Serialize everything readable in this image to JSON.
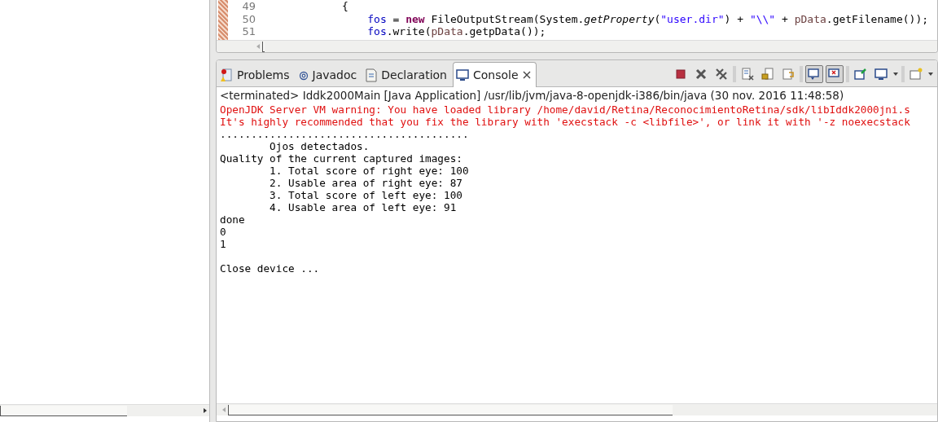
{
  "editor": {
    "lines": [
      {
        "number": "49",
        "tokens": [
          {
            "kind": "plain",
            "text": "            {"
          }
        ]
      },
      {
        "number": "50",
        "tokens": [
          {
            "kind": "field",
            "text": "                fos"
          },
          {
            "kind": "plain",
            "text": " = "
          },
          {
            "kind": "keyword",
            "text": "new"
          },
          {
            "kind": "plain",
            "text": " FileOutputStream(System."
          },
          {
            "kind": "static",
            "text": "getProperty"
          },
          {
            "kind": "plain",
            "text": "("
          },
          {
            "kind": "string",
            "text": "\"user.dir\""
          },
          {
            "kind": "plain",
            "text": ") + "
          },
          {
            "kind": "string",
            "text": "\"\\\\\""
          },
          {
            "kind": "plain",
            "text": " + "
          },
          {
            "kind": "param",
            "text": "pData"
          },
          {
            "kind": "plain",
            "text": ".getFilename());"
          }
        ]
      },
      {
        "number": "51",
        "tokens": [
          {
            "kind": "field",
            "text": "                fos"
          },
          {
            "kind": "plain",
            "text": ".write("
          },
          {
            "kind": "param",
            "text": "pData"
          },
          {
            "kind": "plain",
            "text": ".getpData());"
          }
        ]
      }
    ]
  },
  "view_tabs": [
    {
      "label": "Problems",
      "kind": "problems",
      "selected": false
    },
    {
      "label": "Javadoc",
      "kind": "javadoc",
      "selected": false
    },
    {
      "label": "Declaration",
      "kind": "declaration",
      "selected": false
    },
    {
      "label": "Console",
      "kind": "console",
      "selected": true
    }
  ],
  "toolbar": [
    {
      "kind": "terminate",
      "on": false
    },
    {
      "kind": "remove",
      "on": false
    },
    {
      "kind": "remove-all",
      "on": false
    },
    {
      "kind": "sep"
    },
    {
      "kind": "clear",
      "on": false
    },
    {
      "kind": "scroll-lock",
      "on": false
    },
    {
      "kind": "word-wrap",
      "on": false
    },
    {
      "kind": "sep"
    },
    {
      "kind": "show-out",
      "on": true
    },
    {
      "kind": "show-err",
      "on": true
    },
    {
      "kind": "sep"
    },
    {
      "kind": "pin",
      "on": false
    },
    {
      "kind": "display",
      "on": false
    },
    {
      "kind": "caret"
    },
    {
      "kind": "sep"
    },
    {
      "kind": "open",
      "on": false
    },
    {
      "kind": "caret"
    }
  ],
  "console": {
    "header": "<terminated> Iddk2000Main [Java Application] /usr/lib/jvm/java-8-openjdk-i386/bin/java (30 nov. 2016 11:48:58)",
    "lines": [
      {
        "kind": "err",
        "text": "OpenJDK Server VM warning: You have loaded library /home/david/Retina/ReconocimientoRetina/sdk/libIddk2000jni.s"
      },
      {
        "kind": "err",
        "text": "It's highly recommended that you fix the library with 'execstack -c <libfile>', or link it with '-z noexecstack"
      },
      {
        "kind": "out",
        "text": "........................................"
      },
      {
        "kind": "out",
        "text": "\tOjos detectados."
      },
      {
        "kind": "out",
        "text": "Quality of the current captured images:"
      },
      {
        "kind": "out",
        "text": "\t1. Total score of right eye: 100"
      },
      {
        "kind": "out",
        "text": "\t2. Usable area of right eye: 87"
      },
      {
        "kind": "out",
        "text": "\t3. Total score of left eye: 100"
      },
      {
        "kind": "out",
        "text": "\t4. Usable area of left eye: 91"
      },
      {
        "kind": "out",
        "text": "done"
      },
      {
        "kind": "out",
        "text": "0"
      },
      {
        "kind": "out",
        "text": "1"
      },
      {
        "kind": "blank"
      },
      {
        "kind": "out",
        "text": "Close device ..."
      }
    ]
  }
}
